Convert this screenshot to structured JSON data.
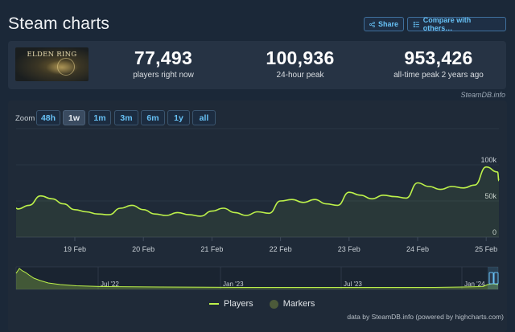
{
  "header": {
    "title": "Steam charts",
    "share_label": "Share",
    "compare_label": "Compare with others…"
  },
  "game": {
    "logo_text": "ELDEN RING"
  },
  "stats": [
    {
      "value": "77,493",
      "label": "players right now"
    },
    {
      "value": "100,936",
      "label": "24-hour peak"
    },
    {
      "value": "953,426",
      "label": "all-time peak 2 years ago"
    }
  ],
  "steamdb_tag": "SteamDB.info",
  "zoom": {
    "label": "Zoom",
    "options": [
      "48h",
      "1w",
      "1m",
      "3m",
      "6m",
      "1y",
      "all"
    ],
    "active": "1w"
  },
  "legend": {
    "players": "Players",
    "markers": "Markers"
  },
  "credit": "data by SteamDB.info (powered by highcharts.com)",
  "colors": {
    "background": "#1b2838",
    "line": "#bdf24a",
    "accent": "#67c1f5"
  },
  "chart_data": {
    "type": "area",
    "series": [
      {
        "name": "Players",
        "x": [
          "Feb 18 00:00",
          "Feb 18 04:00",
          "Feb 18 08:00",
          "Feb 18 12:00",
          "Feb 18 16:00",
          "Feb 18 20:00",
          "Feb 19 00:00",
          "Feb 19 04:00",
          "Feb 19 08:00",
          "Feb 19 12:00",
          "Feb 19 16:00",
          "Feb 19 20:00",
          "Feb 20 00:00",
          "Feb 20 04:00",
          "Feb 20 08:00",
          "Feb 20 12:00",
          "Feb 20 16:00",
          "Feb 20 20:00",
          "Feb 21 00:00",
          "Feb 21 04:00",
          "Feb 21 08:00",
          "Feb 21 12:00",
          "Feb 21 16:00",
          "Feb 21 20:00",
          "Feb 22 00:00",
          "Feb 22 04:00",
          "Feb 22 08:00",
          "Feb 22 12:00",
          "Feb 22 16:00",
          "Feb 22 20:00",
          "Feb 23 00:00",
          "Feb 23 04:00",
          "Feb 23 08:00",
          "Feb 23 12:00",
          "Feb 23 16:00",
          "Feb 23 20:00",
          "Feb 24 00:00",
          "Feb 24 04:00",
          "Feb 24 08:00",
          "Feb 24 12:00",
          "Feb 24 16:00",
          "Feb 24 20:00",
          "Feb 25 00:00",
          "Feb 25 04:00",
          "Feb 25 08:00"
        ],
        "values": [
          40000,
          39000,
          44000,
          57000,
          53000,
          46000,
          38000,
          35000,
          32000,
          31000,
          40000,
          44000,
          38000,
          32000,
          30000,
          34000,
          31000,
          29000,
          36000,
          40000,
          34000,
          30000,
          35000,
          33000,
          50000,
          52000,
          48000,
          52000,
          46000,
          44000,
          62000,
          58000,
          53000,
          58000,
          56000,
          54000,
          75000,
          70000,
          66000,
          70000,
          68000,
          72000,
          97000,
          90000,
          78000
        ]
      }
    ],
    "x_ticks": [
      "19 Feb",
      "20 Feb",
      "21 Feb",
      "22 Feb",
      "23 Feb",
      "24 Feb",
      "25 Feb"
    ],
    "y_ticks": [
      "0",
      "50k",
      "100k"
    ],
    "ylim": [
      0,
      150000
    ],
    "grid": true,
    "navigator_ticks": [
      "Jul '22",
      "Jan '23",
      "Jul '23",
      "Jan '24"
    ]
  }
}
